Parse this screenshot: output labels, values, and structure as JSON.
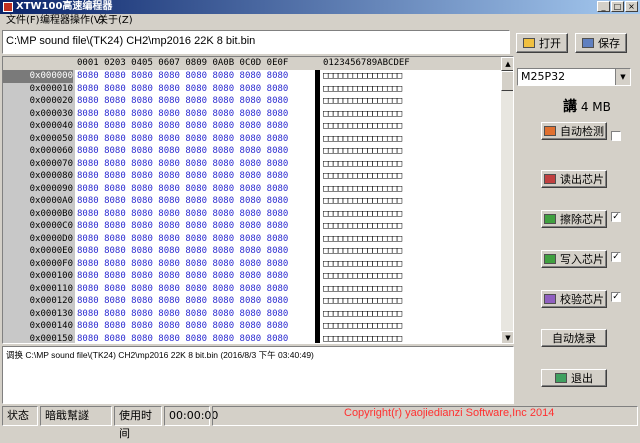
{
  "window": {
    "title": "XTW100高速编程器"
  },
  "menu": [
    "文件(F)",
    "编程器操作(V)",
    "关于(Z)"
  ],
  "path": {
    "value": "C:\\MP sound file\\(TK24) CH2\\mp2016 22K 8 bit.bin"
  },
  "toolbar": {
    "open_label": "打开",
    "save_label": "保存"
  },
  "hex": {
    "column_header": "0001 0203 0405 0607 0809 0A0B 0C0D 0E0F",
    "ascii_header": "0123456789ABCDEF",
    "rows": [
      {
        "addr": "0x000000",
        "hex": "8080 8080 8080 8080 8080 8080 8080 8080",
        "ascii": "□□□□□□□□□□□□□□□□"
      },
      {
        "addr": "0x000010",
        "hex": "8080 8080 8080 8080 8080 8080 8080 8080",
        "ascii": "□□□□□□□□□□□□□□□□"
      },
      {
        "addr": "0x000020",
        "hex": "8080 8080 8080 8080 8080 8080 8080 8080",
        "ascii": "□□□□□□□□□□□□□□□□"
      },
      {
        "addr": "0x000030",
        "hex": "8080 8080 8080 8080 8080 8080 8080 8080",
        "ascii": "□□□□□□□□□□□□□□□□"
      },
      {
        "addr": "0x000040",
        "hex": "8080 8080 8080 8080 8080 8080 8080 8080",
        "ascii": "□□□□□□□□□□□□□□□□"
      },
      {
        "addr": "0x000050",
        "hex": "8080 8080 8080 8080 8080 8080 8080 8080",
        "ascii": "□□□□□□□□□□□□□□□□"
      },
      {
        "addr": "0x000060",
        "hex": "8080 8080 8080 8080 8080 8080 8080 8080",
        "ascii": "□□□□□□□□□□□□□□□□"
      },
      {
        "addr": "0x000070",
        "hex": "8080 8080 8080 8080 8080 8080 8080 8080",
        "ascii": "□□□□□□□□□□□□□□□□"
      },
      {
        "addr": "0x000080",
        "hex": "8080 8080 8080 8080 8080 8080 8080 8080",
        "ascii": "□□□□□□□□□□□□□□□□"
      },
      {
        "addr": "0x000090",
        "hex": "8080 8080 8080 8080 8080 8080 8080 8080",
        "ascii": "□□□□□□□□□□□□□□□□"
      },
      {
        "addr": "0x0000A0",
        "hex": "8080 8080 8080 8080 8080 8080 8080 8080",
        "ascii": "□□□□□□□□□□□□□□□□"
      },
      {
        "addr": "0x0000B0",
        "hex": "8080 8080 8080 8080 8080 8080 8080 8080",
        "ascii": "□□□□□□□□□□□□□□□□"
      },
      {
        "addr": "0x0000C0",
        "hex": "8080 8080 8080 8080 8080 8080 8080 8080",
        "ascii": "□□□□□□□□□□□□□□□□"
      },
      {
        "addr": "0x0000D0",
        "hex": "8080 8080 8080 8080 8080 8080 8080 8080",
        "ascii": "□□□□□□□□□□□□□□□□"
      },
      {
        "addr": "0x0000E0",
        "hex": "8080 8080 8080 8080 8080 8080 8080 8080",
        "ascii": "□□□□□□□□□□□□□□□□"
      },
      {
        "addr": "0x0000F0",
        "hex": "8080 8080 8080 8080 8080 8080 8080 8080",
        "ascii": "□□□□□□□□□□□□□□□□"
      },
      {
        "addr": "0x000100",
        "hex": "8080 8080 8080 8080 8080 8080 8080 8080",
        "ascii": "□□□□□□□□□□□□□□□□"
      },
      {
        "addr": "0x000110",
        "hex": "8080 8080 8080 8080 8080 8080 8080 8080",
        "ascii": "□□□□□□□□□□□□□□□□"
      },
      {
        "addr": "0x000120",
        "hex": "8080 8080 8080 8080 8080 8080 8080 8080",
        "ascii": "□□□□□□□□□□□□□□□□"
      },
      {
        "addr": "0x000130",
        "hex": "8080 8080 8080 8080 8080 8080 8080 8080",
        "ascii": "□□□□□□□□□□□□□□□□"
      },
      {
        "addr": "0x000140",
        "hex": "8080 8080 8080 8080 8080 8080 8080 8080",
        "ascii": "□□□□□□□□□□□□□□□□"
      },
      {
        "addr": "0x000150",
        "hex": "8080 8080 8080 8080 8080 8080 8080 8080",
        "ascii": "□□□□□□□□□□□□□□□□"
      }
    ]
  },
  "log": {
    "text": "调换 C:\\MP sound file\\(TK24) CH2\\mp2016 22K 8 bit.bin (2016/8/3 下午 03:40:49)"
  },
  "chip": {
    "selected": "M25P32",
    "capacity_glyph": "講",
    "capacity": "4 MB"
  },
  "actions": {
    "auto_detect": "自动检测",
    "read": "读出芯片",
    "erase": "擦除芯片",
    "write": "写入芯片",
    "verify": "校验芯片",
    "auto_burn": "自动烧录",
    "exit": "退出"
  },
  "checks": {
    "auto_detect": false,
    "erase": true,
    "write": true,
    "verify": true
  },
  "status": {
    "label": "状态",
    "value": "暗戢幫譢",
    "time_label": "使用时间",
    "time_value": "00:00:00",
    "copyright": "Copyright(r) yaojiedianzi Software,Inc 2014"
  },
  "colors": {
    "hex_text": "#2a2ad0",
    "copyright": "#ff3030",
    "title_start": "#0a246a"
  }
}
